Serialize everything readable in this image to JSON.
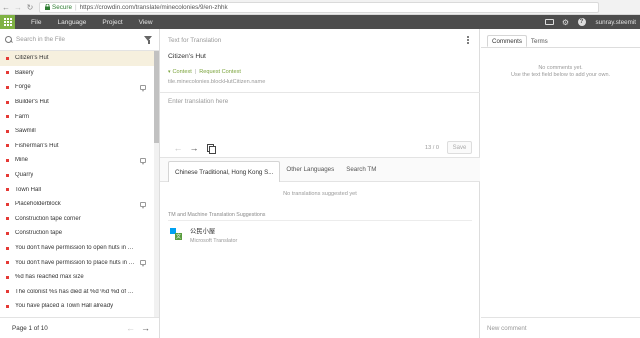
{
  "browser": {
    "secure_label": "Secure",
    "url": "https://crowdin.com/translate/minecolonies/9/en-zhhk",
    "back_icon": "arrow-left-icon",
    "forward_icon": "arrow-right-icon",
    "reload_icon": "reload-icon",
    "reload_glyph": "↻",
    "back_glyph": "←",
    "forward_glyph": "→",
    "url_sep": "|"
  },
  "topbar": {
    "accent_color": "#7fb244",
    "menu": [
      "File",
      "Language",
      "Project",
      "View"
    ],
    "user": "sunray.steemit",
    "help_glyph": "?",
    "gear_glyph": "⚙"
  },
  "left": {
    "search_placeholder": "Search in the File",
    "items": [
      {
        "label": "Citizen's Hut",
        "active": true,
        "comment": false
      },
      {
        "label": "Bakery",
        "active": false,
        "comment": false
      },
      {
        "label": "Forge",
        "active": false,
        "comment": true
      },
      {
        "label": "Builder's Hut",
        "active": false,
        "comment": false
      },
      {
        "label": "Farm",
        "active": false,
        "comment": false
      },
      {
        "label": "Sawmill",
        "active": false,
        "comment": false
      },
      {
        "label": "Fisherman's Hut",
        "active": false,
        "comment": false
      },
      {
        "label": "Mine",
        "active": false,
        "comment": true
      },
      {
        "label": "Quarry",
        "active": false,
        "comment": false
      },
      {
        "label": "Town Hall",
        "active": false,
        "comment": false
      },
      {
        "label": "Placeholderblock",
        "active": false,
        "comment": true
      },
      {
        "label": "Construction tape corner",
        "active": false,
        "comment": false
      },
      {
        "label": "Construction tape",
        "active": false,
        "comment": false
      },
      {
        "label": "You don't have permission to open huts in %s.",
        "active": false,
        "comment": false
      },
      {
        "label": "You don't have permission to place huts in %s.",
        "active": false,
        "comment": true
      },
      {
        "label": "%d has reached max size",
        "active": false,
        "comment": false
      },
      {
        "label": "The colonist %s has died at %d %d %d of %s!",
        "active": false,
        "comment": false
      },
      {
        "label": "You have placed a Town Hall already",
        "active": false,
        "comment": false
      }
    ],
    "status_color": "#e53935",
    "pager_text": "Page 1 of 10",
    "prev_glyph": "←",
    "next_glyph": "→"
  },
  "center": {
    "header_label": "Text for Translation",
    "source_string": "Citizen's Hut",
    "context_chevron": "▾",
    "context_label": "Context",
    "context_sep": "|",
    "request_context_label": "Request Context",
    "key": "tile.minecolonies.blockHutCitizen.name",
    "translation_placeholder": "Enter translation here",
    "undo_glyph": "←",
    "redo_glyph": "→",
    "char_count": "13 / 0",
    "save_label": "Save",
    "tabs": [
      "Chinese Traditional, Hong Kong S...",
      "Other Languages",
      "Search TM"
    ],
    "empty_message": "No translations suggested yet",
    "section_label": "TM and Machine Translation Suggestions",
    "mt_translation": "公民小屋",
    "mt_provider": "Microsoft Translator",
    "mt_badge_letter": "文"
  },
  "right": {
    "tabs": [
      "Comments",
      "Terms"
    ],
    "no_comments": "No comments yet.",
    "no_comments_hint": "Use the text field below to add your own.",
    "new_comment_placeholder": "New comment"
  }
}
